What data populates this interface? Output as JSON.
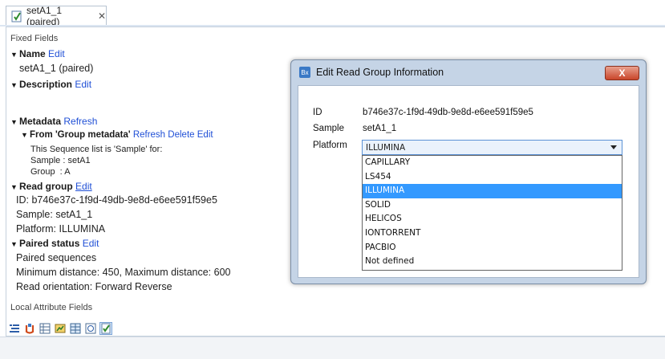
{
  "tab": {
    "title": "setA1_1 (paired)",
    "close": "✕"
  },
  "left": {
    "fixed_fields": "Fixed Fields",
    "name": {
      "label": "Name",
      "action": "Edit",
      "value": "setA1_1 (paired)"
    },
    "description": {
      "label": "Description",
      "action": "Edit"
    },
    "metadata": {
      "label": "Metadata",
      "action": "Refresh",
      "group": {
        "label": "From 'Group metadata'",
        "actions": [
          "Refresh",
          "Delete",
          "Edit"
        ]
      },
      "lines": [
        "This Sequence list is 'Sample' for:",
        "Sample : setA1",
        "Group  : A"
      ]
    },
    "read_group": {
      "label": "Read group",
      "action": "Edit",
      "lines": [
        "ID: b746e37c-1f9d-49db-9e8d-e6ee591f59e5",
        "Sample: setA1_1",
        "Platform: ILLUMINA"
      ]
    },
    "paired_status": {
      "label": "Paired status",
      "action": "Edit",
      "lines": [
        "Paired sequences",
        "Minimum distance: 450, Maximum distance: 600",
        "Read orientation: Forward Reverse"
      ]
    },
    "local_attribute_fields": "Local Attribute Fields"
  },
  "dialog": {
    "title": "Edit Read Group Information",
    "app_icon": "Bx",
    "close": "X",
    "id_label": "ID",
    "id_value": "b746e37c-1f9d-49db-9e8d-e6ee591f59e5",
    "sample_label": "Sample",
    "sample_value": "setA1_1",
    "platform_label": "Platform",
    "platform_selected": "ILLUMINA",
    "options": [
      "CAPILLARY",
      "LS454",
      "ILLUMINA",
      "SOLID",
      "HELICOS",
      "IONTORRENT",
      "PACBIO",
      "Not defined"
    ],
    "highlighted_option": "ILLUMINA"
  },
  "colors": {
    "link": "#1f4fd6",
    "selection": "#3399ff",
    "close_button": "#c9452a"
  },
  "toolbar_icons": [
    "text-format-icon",
    "undo-icon",
    "table-icon",
    "graph-icon",
    "grid-icon",
    "history-icon",
    "element-info-icon"
  ]
}
